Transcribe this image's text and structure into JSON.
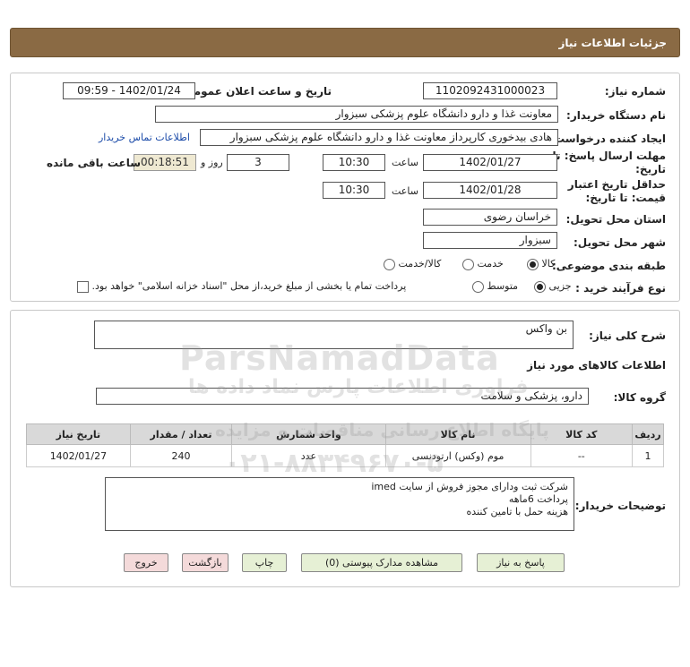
{
  "header": {
    "title": "جزئیات اطلاعات نیاز"
  },
  "form": {
    "need_number": {
      "label": "شماره نیاز:",
      "value": "1102092431000023"
    },
    "announce": {
      "label": "تاریخ و ساعت اعلان عمومی:",
      "value": "1402/01/24 - 09:59"
    },
    "buyer_org": {
      "label": "نام دستگاه خریدار:",
      "value": "معاونت غذا و دارو   دانشگاه علوم پزشکی سبزوار"
    },
    "requester": {
      "label": "ایجاد کننده درخواست:",
      "value": "هادی بیدخوری کارپرداز معاونت غذا و دارو   دانشگاه علوم پزشکی سبزوار"
    },
    "contact_link": "اطلاعات تماس خریدار",
    "reply_deadline": {
      "label_line1": "مهلت ارسال پاسخ: تا",
      "label_line2": "تاریخ:",
      "date": "1402/01/27",
      "time_label": "ساعت",
      "time": "10:30",
      "days": "3",
      "days_label": "روز و",
      "remaining": "00:18:51",
      "remaining_label": "ساعت باقی مانده"
    },
    "price_validity": {
      "label_line1": "حداقل تاریخ اعتبار",
      "label_line2": "قیمت: تا تاریخ:",
      "date": "1402/01/28",
      "time_label": "ساعت",
      "time": "10:30"
    },
    "delivery_province": {
      "label": "استان محل تحویل:",
      "value": "خراسان رضوی"
    },
    "delivery_city": {
      "label": "شهر محل تحویل:",
      "value": "سبزوار"
    },
    "category": {
      "label": "طبقه بندی موضوعی:",
      "options": [
        "کالا",
        "خدمت",
        "کالا/خدمت"
      ],
      "selected": "کالا"
    },
    "process_type": {
      "label": "نوع فرآیند خرید :",
      "options": [
        "جزیی",
        "متوسط"
      ],
      "selected": "جزیی",
      "checkbox_label": "پرداخت تمام یا بخشی از مبلغ خرید،از محل \"اسناد خزانه اسلامی\" خواهد بود."
    }
  },
  "summary": {
    "label": "شرح کلی نیاز:",
    "value": "بن واکس"
  },
  "goods_section": {
    "title": "اطلاعات کالاهای مورد نیاز"
  },
  "goods_group": {
    "label": "گروه کالا:",
    "value": "دارو، پزشکی و سلامت"
  },
  "table": {
    "headers": [
      "ردیف",
      "کد کالا",
      "نام کالا",
      "واحد شمارش",
      "تعداد / مقدار",
      "تاریخ نیاز"
    ],
    "rows": [
      [
        "1",
        "--",
        "موم (وکس) ارتودنسی",
        "عدد",
        "240",
        "1402/01/27"
      ]
    ]
  },
  "buyer_notes": {
    "label": "توضیحات خریدار:",
    "lines": [
      "شرکت ثبت ودارای مجوز فروش از سایت imed",
      "پرداخت 6ماهه",
      "هزینه حمل با تامین کننده"
    ]
  },
  "buttons": {
    "reply": "پاسخ به نیاز",
    "view_docs": "مشاهده مدارک پیوستی (0)",
    "print": "چاپ",
    "back": "بازگشت",
    "exit": "خروج"
  },
  "watermark": {
    "brand": "ParsNamadData",
    "line1": "پایگاه اطلاع رسانی مناقصات و مزایده",
    "line2": "فراوری اطلاعات پارس نماد داده ها",
    "phone": "۰۲۱-۸۸۳۴۹۶۷۰-۵"
  },
  "colors": {
    "header_bg": "#8a6a44",
    "button_bg": "#e6f0d5",
    "button_pink": "#f4dada"
  }
}
